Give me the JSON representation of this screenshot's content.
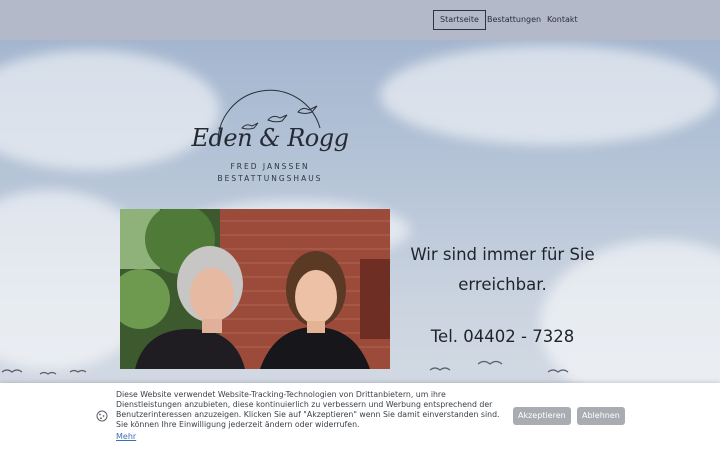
{
  "nav": {
    "items": [
      {
        "label": "Startseite",
        "active": true
      },
      {
        "label": "Bestattungen",
        "active": false
      },
      {
        "label": "Kontakt",
        "active": false
      }
    ]
  },
  "logo": {
    "title": "Eden & Rogg",
    "subtitle_1": "FRED JANSSEN",
    "subtitle_2": "BESTATTUNGSHAUS"
  },
  "hero": {
    "headline": "Wir sind immer für Sie erreichbar.",
    "phone": "Tel. 04402 - 7328"
  },
  "cookie_banner": {
    "text": "Diese Website verwendet Website-Tracking-Technologien von Drittanbietern, um ihre Dienstleistungen anzubieten, diese kontinuierlich zu verbessern und Werbung entsprechend der Benutzerinteressen anzuzeigen. Klicken Sie auf \"Akzeptieren\" wenn Sie damit einverstanden sind. Sie können Ihre Einwilligung jederzeit ändern oder widerrufen.",
    "more_label": "Mehr",
    "accept_label": "Akzeptieren",
    "decline_label": "Ablehnen",
    "icon": "cookie-icon"
  },
  "colors": {
    "nav_bg": "#b4b9c9",
    "sky": "#b7c5d8",
    "button_bg": "#a9acb2",
    "link": "#3c6fb5"
  }
}
